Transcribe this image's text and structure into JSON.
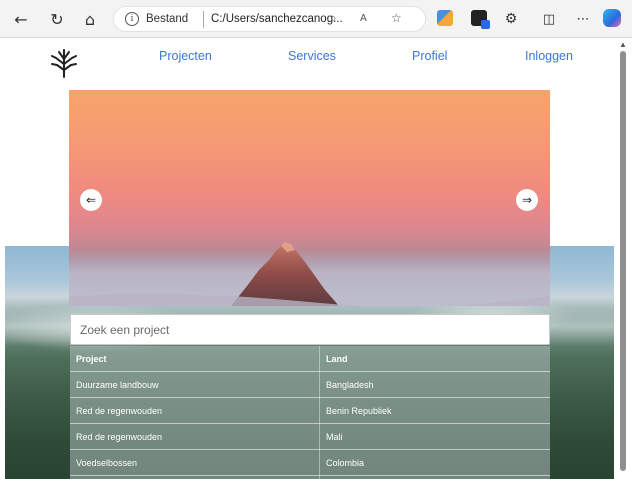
{
  "browser": {
    "site_label": "Bestand",
    "url": "C:/Users/sanchezcanog...",
    "icons": [
      "back-icon",
      "reload-icon",
      "home-icon",
      "info-icon",
      "zoom-icon",
      "read-aloud-icon",
      "favorite-icon",
      "extension-icon",
      "split-screen-icon",
      "more-icon",
      "copilot-icon"
    ]
  },
  "nav": {
    "links": [
      "Projecten",
      "Services",
      "Profiel",
      "Inloggen"
    ]
  },
  "carousel": {
    "prev_label": "⇐",
    "next_label": "⇒"
  },
  "search": {
    "placeholder": "Zoek een project",
    "value": ""
  },
  "table": {
    "headers": [
      "Project",
      "Land"
    ],
    "rows": [
      [
        "Duurzame landbouw",
        "Bangladesh"
      ],
      [
        "Red de regenwouden",
        "Benin Republiek"
      ],
      [
        "Red de regenwouden",
        "Mali"
      ],
      [
        "Voedselbossen",
        "Colombia"
      ]
    ]
  },
  "colors": {
    "nav_link": "#3a78d6"
  }
}
